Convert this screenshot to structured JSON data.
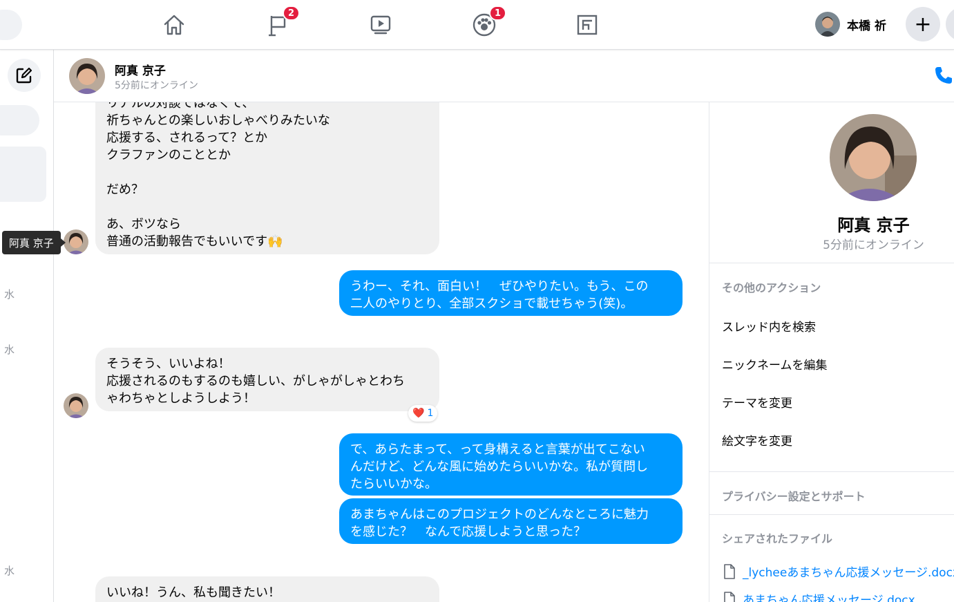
{
  "topbar": {
    "badges": {
      "flag": "2",
      "groups": "1"
    },
    "profile_name": "本橋 祈",
    "plus": "+"
  },
  "left": {
    "day_labels": [
      "水",
      "水",
      "水"
    ]
  },
  "chat": {
    "name": "阿真 京子",
    "status": "5分前にオンライン",
    "tooltip": "阿真 京子",
    "messages": [
      {
        "dir": "in",
        "text": "リアルの対談ではなくて、\n祈ちゃんとの楽しいおしゃべりみたいな\n応援する、されるって？とか\nクラファンのこととか\n\nだめ？\n\nあ、ボツなら\n普通の活動報告でもいいです🙌"
      },
      {
        "dir": "out",
        "text": "うわー、それ、面白い！　ぜひやりたい。もう、この\n二人のやりとり、全部スクショで載せちゃう(笑)。"
      },
      {
        "dir": "in",
        "text": "そうそう、いいよね！\n応援されるのもするのも嬉しい、がしゃがしゃとわち\nゃわちゃとしようしよう！",
        "reaction": {
          "emoji": "❤️",
          "count": "1"
        }
      },
      {
        "dir": "out",
        "text": "で、あらたまって、って身構えると言葉が出てこない\nんだけど、どんな風に始めたらいいかな。私が質問し\nたらいいかな。"
      },
      {
        "dir": "out",
        "text": "あまちゃんはこのプロジェクトのどんなところに魅力\nを感じた？　なんで応援しようと思った？"
      },
      {
        "dir": "in",
        "text": "いいね！うん、私も聞きたい！"
      }
    ]
  },
  "panel": {
    "name": "阿真 京子",
    "status": "5分前にオンライン",
    "more_actions_title": "その他のアクション",
    "actions": [
      "スレッド内を検索",
      "ニックネームを編集",
      "テーマを変更",
      "絵文字を変更"
    ],
    "privacy_title": "プライバシー設定とサポート",
    "files_title": "シェアされたファイル",
    "files": [
      "_lycheeあまちゃん応援メッセージ.docx",
      "あまちゃん応援メッセージ.docx"
    ]
  },
  "colors": {
    "accent": "#0099ff",
    "badge": "#e41e3f",
    "incoming": "#f0f0f0"
  }
}
